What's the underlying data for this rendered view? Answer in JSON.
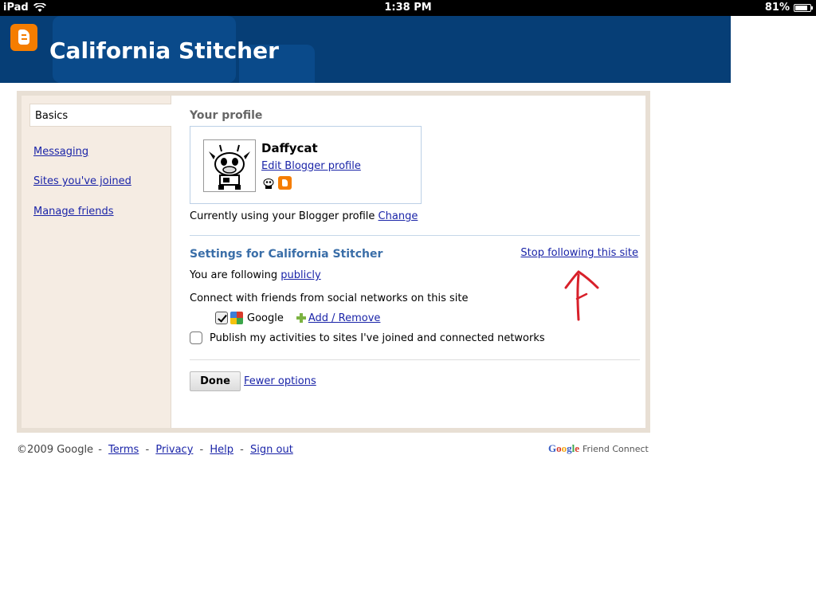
{
  "statusbar": {
    "device": "iPad",
    "time": "1:38 PM",
    "battery": "81%",
    "battery_level": 0.81
  },
  "header": {
    "title": "California Stitcher"
  },
  "sidebar": {
    "items": [
      {
        "label": "Basics"
      },
      {
        "label": "Messaging"
      },
      {
        "label": "Sites you've joined"
      },
      {
        "label": "Manage friends"
      }
    ]
  },
  "profile": {
    "heading": "Your profile",
    "name": "Daffycat",
    "edit_link": "Edit Blogger profile",
    "using_text": "Currently using your Blogger profile",
    "change_link": "Change"
  },
  "settings": {
    "heading": "Settings for California Stitcher",
    "stop_link": "Stop following this site",
    "following_text": "You are following",
    "following_link": "publicly",
    "connect_text": "Connect with friends from social networks on this site",
    "google_label": "Google",
    "add_remove_link": "Add / Remove",
    "publish_text": "Publish my activities to sites I've joined and connected networks",
    "publish_checked": false,
    "google_checked": true
  },
  "actions": {
    "done_label": "Done",
    "fewer_link": "Fewer options"
  },
  "footer": {
    "copyright": "©2009 Google",
    "links": [
      "Terms",
      "Privacy",
      "Help",
      "Sign out"
    ],
    "fc_google": "Google",
    "fc_text": "Friend Connect"
  },
  "colors": {
    "header_bg": "#063e76",
    "blogger_orange": "#f57d00",
    "link": "#1a24a8",
    "annotation_arrow": "#d8202a"
  }
}
